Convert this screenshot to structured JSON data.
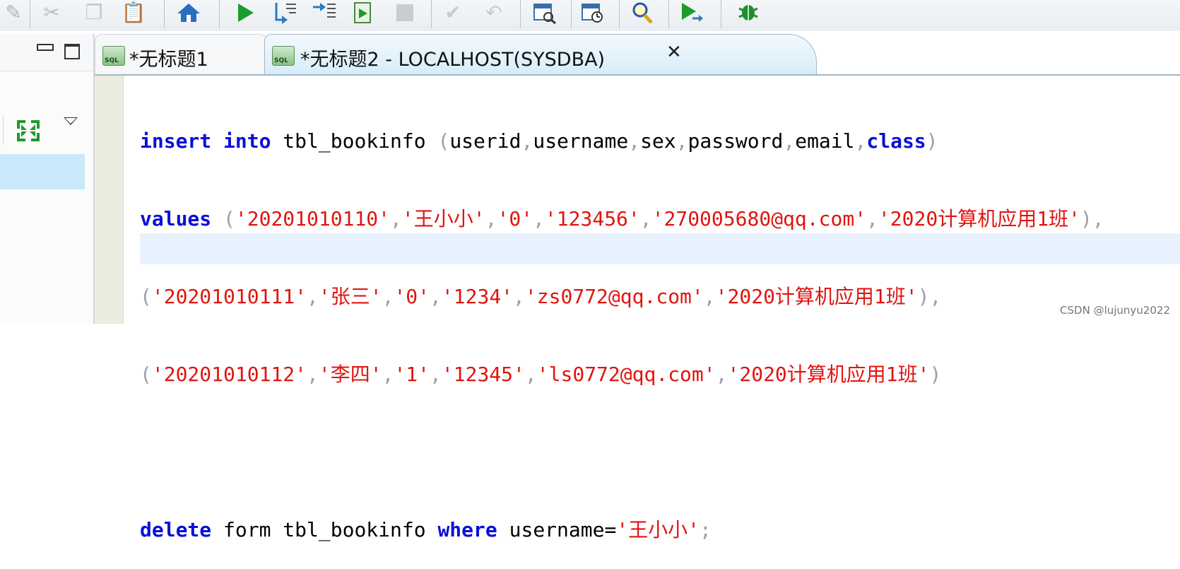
{
  "colors": {
    "keyword": "#0a10d8",
    "string": "#e0140f",
    "punctuation": "#9aa0a6",
    "highlight_line": "#e8f2fe",
    "selected_tree": "#c9e9fb"
  },
  "toolbar": {
    "icons": [
      "edit-icon",
      "cut-icon",
      "copy-icon",
      "paste-icon",
      "home-icon",
      "run-icon",
      "step-into-icon",
      "step-over-icon",
      "run-script-icon",
      "stop-icon",
      "commit-icon",
      "rollback-icon",
      "explain-plan-icon",
      "query-stats-icon",
      "search-icon",
      "debug-run-icon",
      "bug-icon"
    ]
  },
  "tabs": [
    {
      "label": "*无标题1",
      "icon": "sql-icon",
      "active": false
    },
    {
      "label": "*无标题2 - LOCALHOST(SYSDBA)",
      "icon": "sql-icon",
      "active": true,
      "close": "✕"
    }
  ],
  "icon_text": {
    "sql": "SQL"
  },
  "editor": {
    "lines": [
      "insert into tbl_bookinfo (userid,username,sex,password,email,class)",
      "values ('20201010110','王小小','0','123456','270005680@qq.com','2020计算机应用1班'),",
      "('20201010111','张三','0','1234','zs0772@qq.com','2020计算机应用1班'),",
      "('20201010112','李四','1','12345','ls0772@qq.com','2020计算机应用1班')",
      "",
      "delete form tbl_bookinfo where username='王小小';"
    ]
  },
  "watermark": "CSDN @lujunyu2022"
}
